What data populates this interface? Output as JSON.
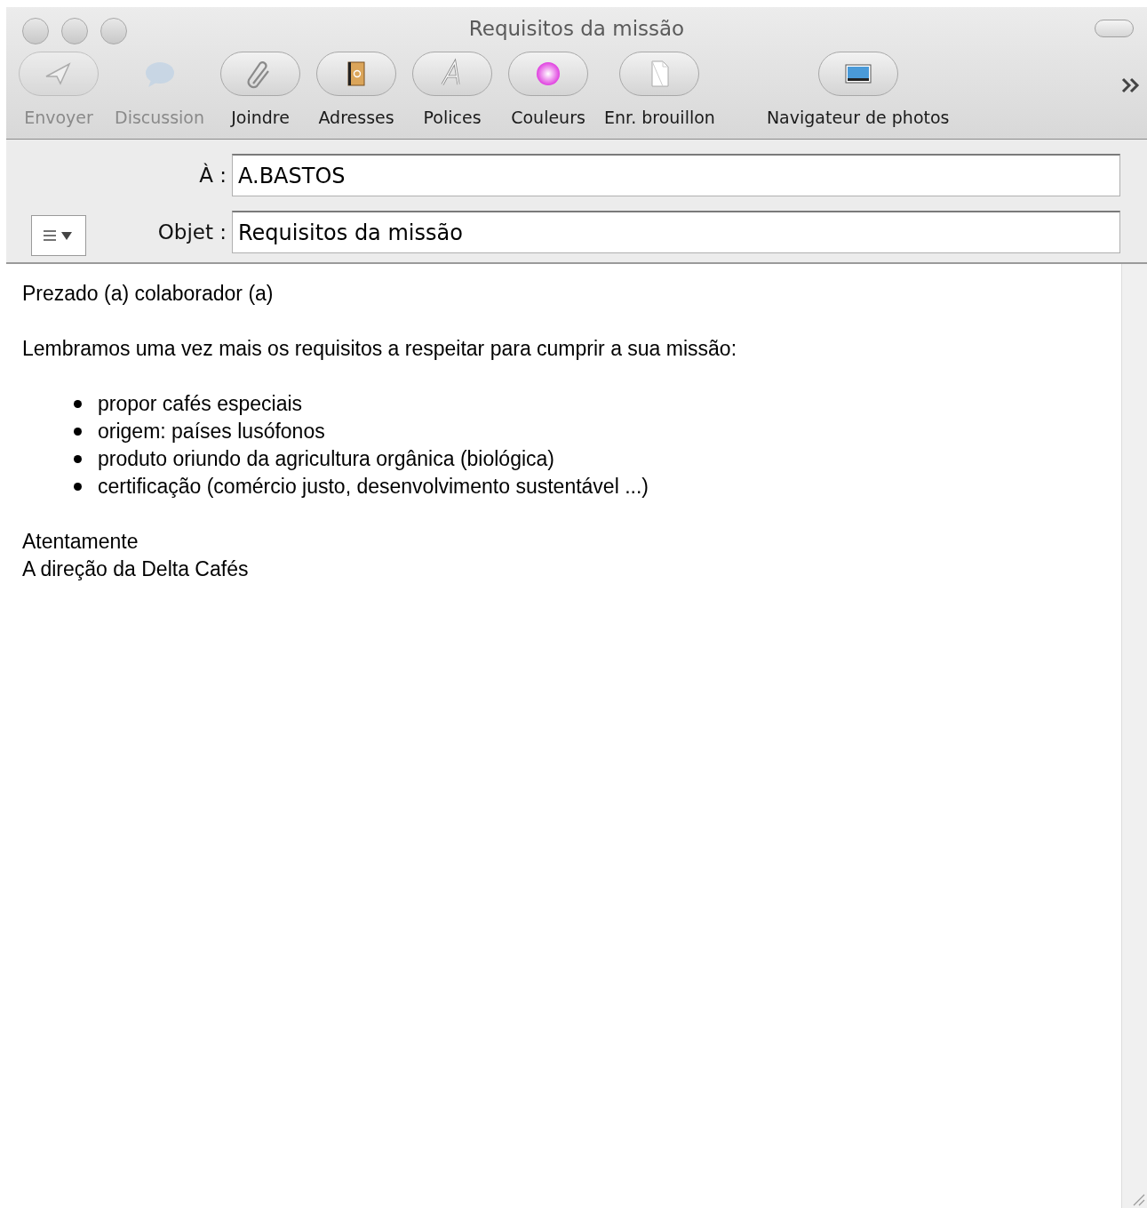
{
  "window": {
    "title": "Requisitos da missão"
  },
  "toolbar": [
    {
      "label": "Envoyer",
      "kind": "send",
      "disabled": true
    },
    {
      "label": "Discussion",
      "kind": "chat",
      "disabled": true
    },
    {
      "label": "Joindre",
      "kind": "attach",
      "disabled": false
    },
    {
      "label": "Adresses",
      "kind": "addressbook",
      "disabled": false
    },
    {
      "label": "Polices",
      "kind": "fonts",
      "disabled": false
    },
    {
      "label": "Couleurs",
      "kind": "colors",
      "disabled": false
    },
    {
      "label": "Enr. brouillon",
      "kind": "draft",
      "disabled": false
    },
    {
      "label": "Navigateur de photos",
      "kind": "photos",
      "disabled": false
    }
  ],
  "header_fields": [
    {
      "label": "À :",
      "value": "A.BASTOS"
    },
    {
      "label": "Objet :",
      "value": "Requisitos da missão"
    }
  ],
  "body": {
    "greeting": "Prezado (a) colaborador (a)",
    "intro": "Lembramos uma vez mais os requisitos a respeitar para cumprir a sua missão:",
    "bullets": [
      "propor cafés especiais",
      "origem: países lusófonos",
      "produto oriundo da agricultura orgânica (biológica)",
      "certificação (comércio justo, desenvolvimento sustentável ...)"
    ],
    "closing": [
      "Atentamente",
      "A direção da Delta Cafés"
    ]
  }
}
